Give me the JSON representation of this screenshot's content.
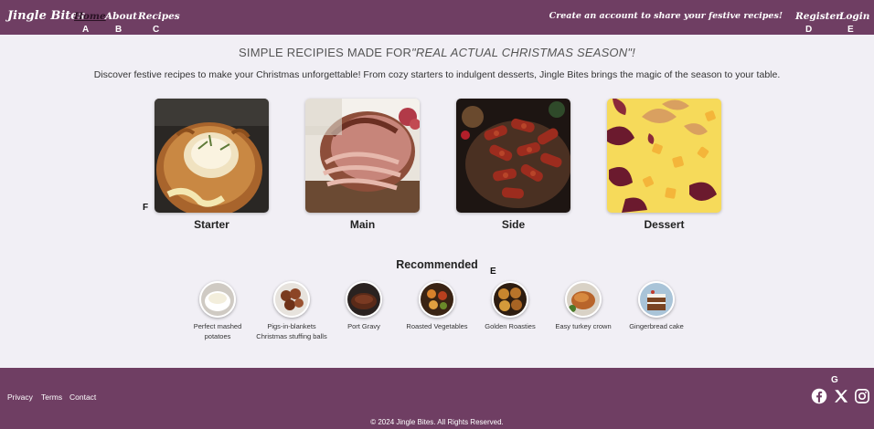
{
  "header": {
    "brand": "Jingle Bites",
    "nav": [
      {
        "label": "Home",
        "marker": "A"
      },
      {
        "label": "About",
        "marker": "B"
      },
      {
        "label": "Recipes",
        "marker": "C"
      }
    ],
    "cta": "Create an account to share your festive recipes!",
    "register": {
      "label": "Register",
      "marker": "D"
    },
    "login": {
      "label": "Login",
      "marker": "E"
    }
  },
  "hero": {
    "title_prefix": "SIMPLE RECIPIES MADE FOR",
    "title_emph": "\"REAL ACTUAL CHRISTMAS SEASON\"!",
    "description": "Discover festive recipes to make your Christmas unforgettable! From cozy starters to indulgent desserts, Jingle Bites brings the magic of the season to your table."
  },
  "categories": {
    "marker": "F",
    "items": [
      {
        "label": "Starter",
        "icon": "baked-camembert-image"
      },
      {
        "label": "Main",
        "icon": "glazed-ham-image"
      },
      {
        "label": "Side",
        "icon": "pigs-in-blankets-image"
      },
      {
        "label": "Dessert",
        "icon": "custard-plum-dessert-image"
      }
    ]
  },
  "recommended": {
    "title": "Recommended",
    "marker": "E",
    "items": [
      {
        "label": "Perfect mashed potatoes"
      },
      {
        "label": "Pigs-in-blankets Christmas stuffing balls"
      },
      {
        "label": "Port Gravy"
      },
      {
        "label": "Roasted Vegetables"
      },
      {
        "label": "Golden Roasties"
      },
      {
        "label": "Easy turkey crown"
      },
      {
        "label": "Gingerbread cake"
      }
    ]
  },
  "footer": {
    "links": [
      "Privacy",
      "Terms",
      "Contact"
    ],
    "copyright": "© 2024 Jingle Bites. All Rights Reserved.",
    "social_marker": "G",
    "social_icons": [
      "facebook-icon",
      "x-icon",
      "instagram-icon"
    ]
  },
  "colors": {
    "header_bg": "#6f3e63",
    "page_bg": "#f1eff5",
    "footer_bg": "#6f3e63"
  }
}
